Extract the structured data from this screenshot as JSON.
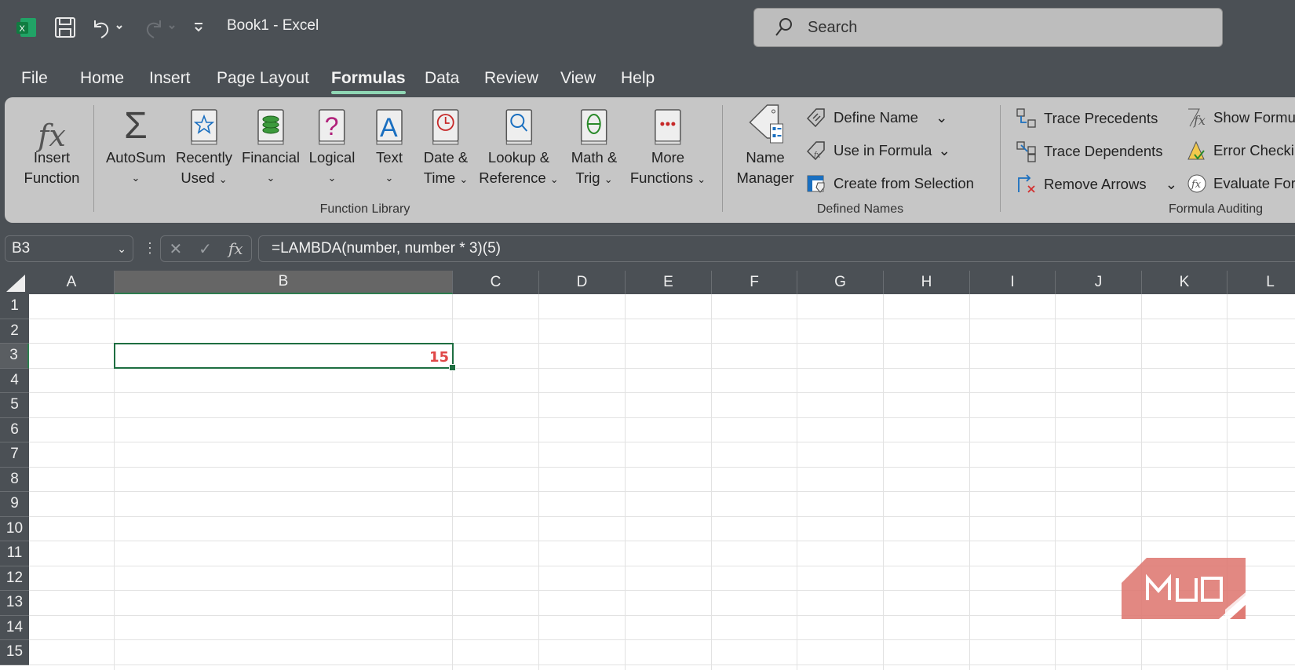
{
  "titlebar": {
    "title": "Book1  -  Excel",
    "search_placeholder": "Search"
  },
  "tabs": [
    {
      "label": "File"
    },
    {
      "label": "Home"
    },
    {
      "label": "Insert"
    },
    {
      "label": "Page Layout"
    },
    {
      "label": "Formulas",
      "active": true
    },
    {
      "label": "Data"
    },
    {
      "label": "Review"
    },
    {
      "label": "View"
    },
    {
      "label": "Help"
    }
  ],
  "ribbon": {
    "function_library": {
      "label": "Function Library",
      "insert_function": [
        "Insert",
        "Function"
      ],
      "autosum": "AutoSum",
      "recently_used": [
        "Recently",
        "Used"
      ],
      "financial": "Financial",
      "logical": "Logical",
      "text": "Text",
      "date_time": [
        "Date &",
        "Time"
      ],
      "lookup": [
        "Lookup &",
        "Reference"
      ],
      "math": [
        "Math &",
        "Trig"
      ],
      "more": [
        "More",
        "Functions"
      ]
    },
    "defined_names": {
      "label": "Defined Names",
      "name_manager": [
        "Name",
        "Manager"
      ],
      "define_name": "Define Name",
      "use_in_formula": "Use in Formula",
      "create_from_selection": "Create from Selection"
    },
    "formula_auditing": {
      "label": "Formula Auditing",
      "trace_precedents": "Trace Precedents",
      "trace_dependents": "Trace Dependents",
      "remove_arrows": "Remove Arrows",
      "show_formulas": "Show Formulas",
      "error_checking": "Error Checking",
      "evaluate_formula": "Evaluate Formula"
    }
  },
  "formula_bar": {
    "name_box": "B3",
    "formula": "=LAMBDA(number, number * 3)(5)"
  },
  "sheet": {
    "columns": [
      "A",
      "B",
      "C",
      "D",
      "E",
      "F",
      "G",
      "H",
      "I",
      "J",
      "K",
      "L"
    ],
    "rows": [
      "1",
      "2",
      "3",
      "4",
      "5",
      "6",
      "7",
      "8",
      "9",
      "10",
      "11",
      "12",
      "13",
      "14",
      "15"
    ],
    "selected_cell": "B3",
    "selected_value": "15",
    "value_color": "#e04848"
  },
  "watermark": "MUO"
}
